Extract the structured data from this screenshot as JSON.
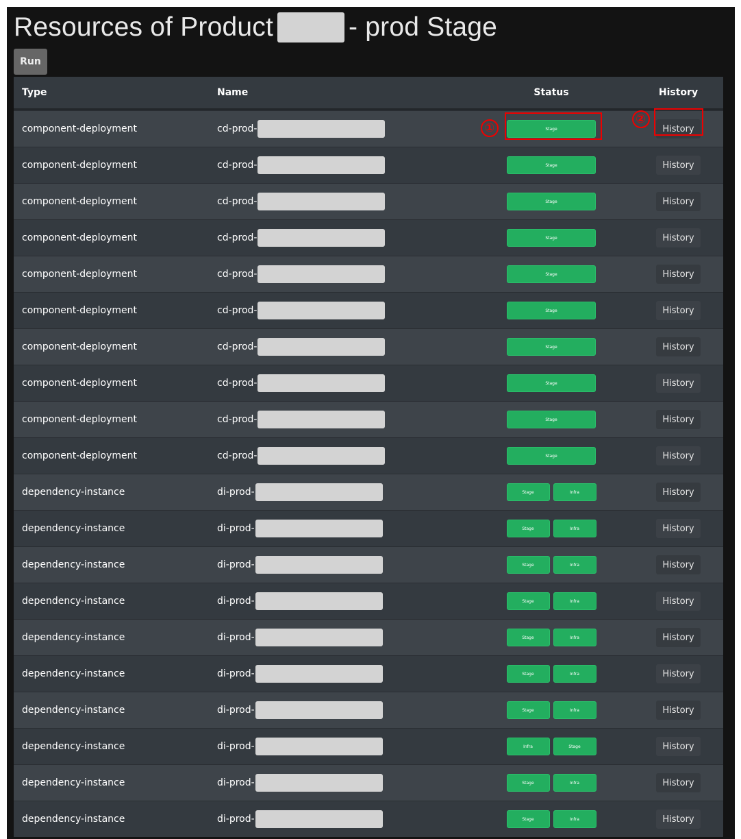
{
  "page": {
    "title_prefix": "Resources of Product",
    "title_suffix": "- prod Stage",
    "run_label": "Run"
  },
  "table": {
    "headers": {
      "type": "Type",
      "name": "Name",
      "status": "Status",
      "history": "History"
    },
    "rows": [
      {
        "type": "component-deployment",
        "name_prefix": "cd-prod-",
        "badges": [
          "Stage"
        ],
        "history": "History"
      },
      {
        "type": "component-deployment",
        "name_prefix": "cd-prod-",
        "badges": [
          "Stage"
        ],
        "history": "History"
      },
      {
        "type": "component-deployment",
        "name_prefix": "cd-prod-",
        "badges": [
          "Stage"
        ],
        "history": "History"
      },
      {
        "type": "component-deployment",
        "name_prefix": "cd-prod-",
        "badges": [
          "Stage"
        ],
        "history": "History"
      },
      {
        "type": "component-deployment",
        "name_prefix": "cd-prod-",
        "badges": [
          "Stage"
        ],
        "history": "History"
      },
      {
        "type": "component-deployment",
        "name_prefix": "cd-prod-",
        "badges": [
          "Stage"
        ],
        "history": "History"
      },
      {
        "type": "component-deployment",
        "name_prefix": "cd-prod-",
        "badges": [
          "Stage"
        ],
        "history": "History"
      },
      {
        "type": "component-deployment",
        "name_prefix": "cd-prod-",
        "badges": [
          "Stage"
        ],
        "history": "History"
      },
      {
        "type": "component-deployment",
        "name_prefix": "cd-prod-",
        "badges": [
          "Stage"
        ],
        "history": "History"
      },
      {
        "type": "component-deployment",
        "name_prefix": "cd-prod-",
        "badges": [
          "Stage"
        ],
        "history": "History"
      },
      {
        "type": "dependency-instance",
        "name_prefix": "di-prod-",
        "badges": [
          "Stage",
          "Infra"
        ],
        "history": "History"
      },
      {
        "type": "dependency-instance",
        "name_prefix": "di-prod-",
        "badges": [
          "Stage",
          "Infra"
        ],
        "history": "History"
      },
      {
        "type": "dependency-instance",
        "name_prefix": "di-prod-",
        "badges": [
          "Stage",
          "Infra"
        ],
        "history": "History"
      },
      {
        "type": "dependency-instance",
        "name_prefix": "di-prod-",
        "badges": [
          "Stage",
          "Infra"
        ],
        "history": "History"
      },
      {
        "type": "dependency-instance",
        "name_prefix": "di-prod-",
        "badges": [
          "Stage",
          "Infra"
        ],
        "history": "History"
      },
      {
        "type": "dependency-instance",
        "name_prefix": "di-prod-",
        "badges": [
          "Stage",
          "Infra"
        ],
        "history": "History"
      },
      {
        "type": "dependency-instance",
        "name_prefix": "di-prod-",
        "badges": [
          "Stage",
          "Infra"
        ],
        "history": "History"
      },
      {
        "type": "dependency-instance",
        "name_prefix": "di-prod-",
        "badges": [
          "Infra",
          "Stage"
        ],
        "history": "History"
      },
      {
        "type": "dependency-instance",
        "name_prefix": "di-prod-",
        "badges": [
          "Stage",
          "Infra"
        ],
        "history": "History"
      },
      {
        "type": "dependency-instance",
        "name_prefix": "di-prod-",
        "badges": [
          "Stage",
          "Infra"
        ],
        "history": "History"
      }
    ]
  },
  "annotations": [
    {
      "label": "①",
      "target": "status-badge"
    },
    {
      "label": "②",
      "target": "history-button"
    }
  ],
  "colors": {
    "badge_green": "#23ae5f",
    "annotation_red": "#ee0000",
    "background": "#131313"
  }
}
